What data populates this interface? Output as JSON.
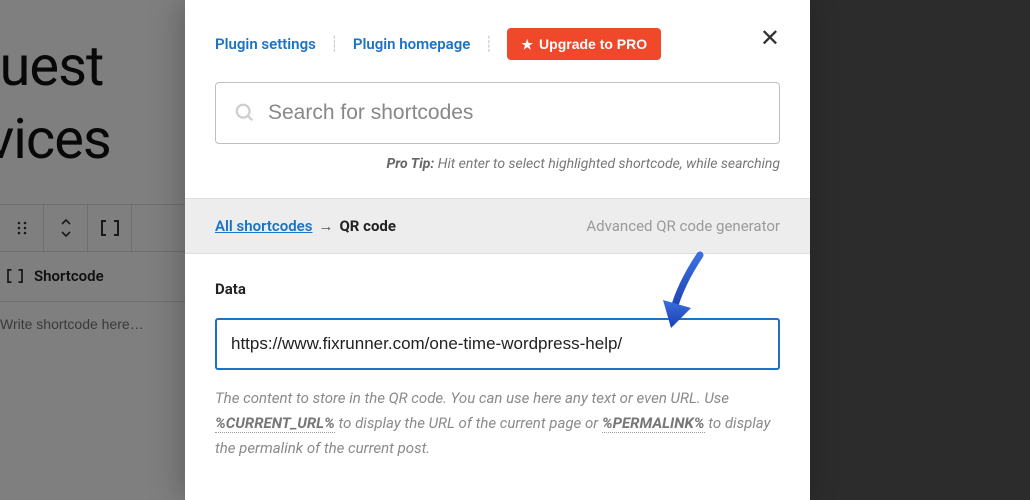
{
  "background": {
    "title_line1": "equest",
    "title_line2": "ervices",
    "block_label": "Shortcode",
    "placeholder": "Write shortcode here…"
  },
  "modal": {
    "links": {
      "settings": "Plugin settings",
      "homepage": "Plugin homepage"
    },
    "upgrade_label": "Upgrade to PRO",
    "search_placeholder": "Search for shortcodes",
    "protip_label": "Pro Tip:",
    "protip_text": "Hit enter to select highlighted shortcode, while searching",
    "breadcrumb": {
      "root": "All shortcodes",
      "arrow": "→",
      "current": "QR code",
      "description": "Advanced QR code generator"
    },
    "field": {
      "label": "Data",
      "value": "https://www.fixrunner.com/one-time-wordpress-help/",
      "help_part1": "The content to store in the QR code. You can use here any text or even URL. Use ",
      "help_ph1": "%CURRENT_URL%",
      "help_part2": " to display the URL of the current page or ",
      "help_ph2": "%PERMALINK%",
      "help_part3": " to display the permalink of the current post."
    }
  }
}
